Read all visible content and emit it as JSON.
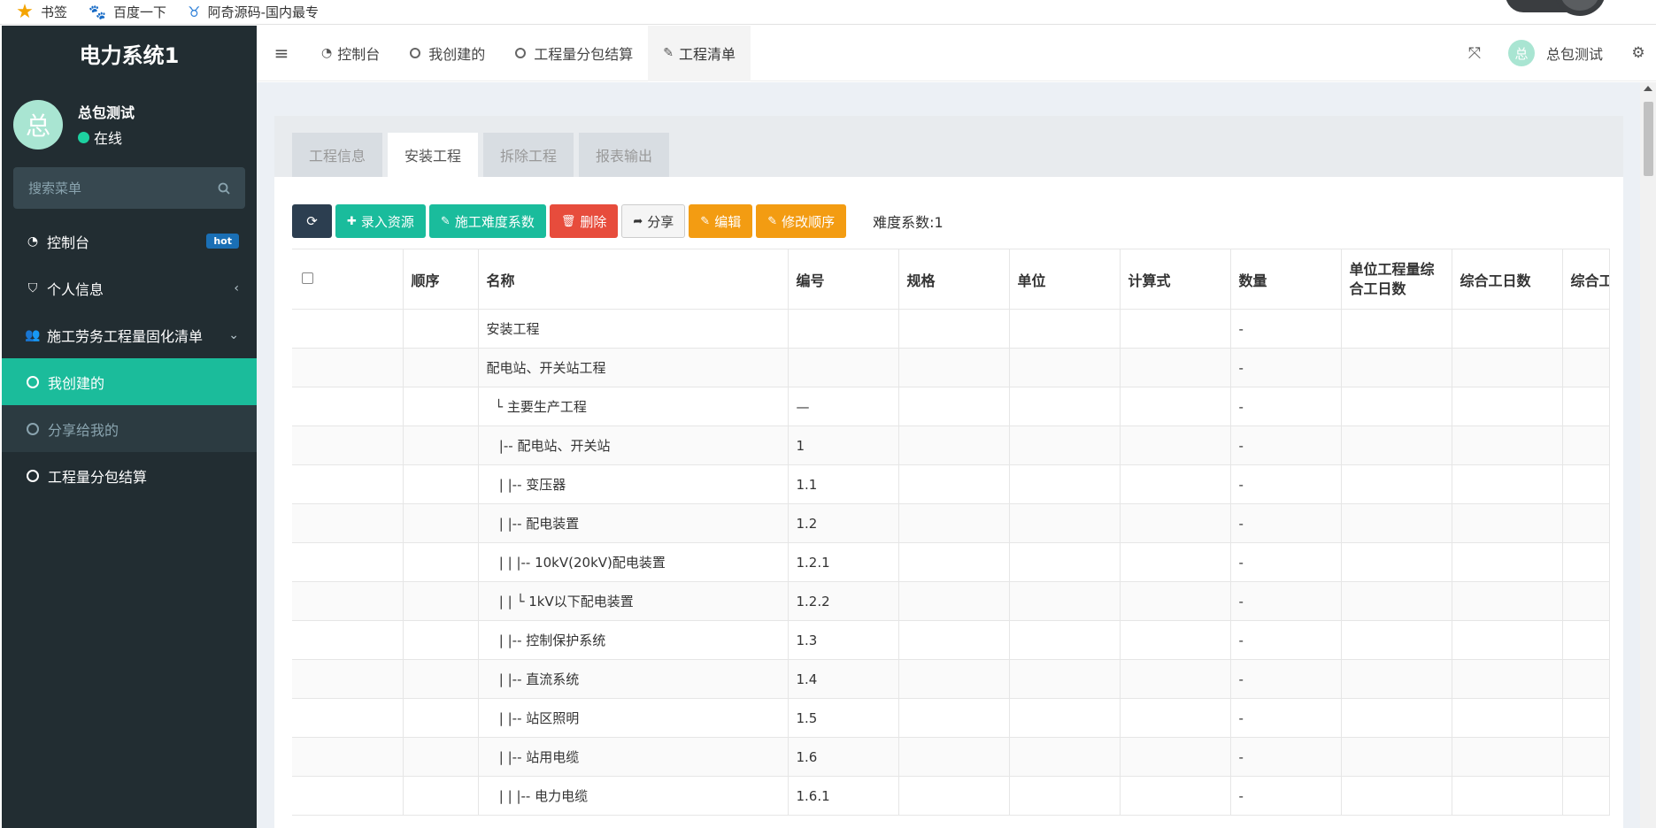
{
  "bookmarks": {
    "items": [
      {
        "label": "书签",
        "icon": "star-icon"
      },
      {
        "label": "百度一下",
        "icon": "baidu-paw-icon"
      },
      {
        "label": "阿奇源码-国内最专",
        "icon": "site-cow-icon"
      }
    ]
  },
  "sidebar": {
    "logo": "电力系统1",
    "user": {
      "avatar_char": "总",
      "name": "总包测试",
      "status": "在线"
    },
    "search_placeholder": "搜索菜单",
    "items": [
      {
        "label": "控制台",
        "icon": "dashboard-icon",
        "badge": "hot"
      },
      {
        "label": "个人信息",
        "icon": "shield-icon",
        "chevron": "‹"
      },
      {
        "label": "施工劳务工程量固化清单",
        "icon": "users-icon",
        "chevron": "⌄"
      },
      {
        "label": "我创建的",
        "icon": "circle-icon",
        "active": true
      },
      {
        "label": "分享给我的",
        "icon": "circle-icon"
      },
      {
        "label": "工程量分包结算",
        "icon": "circle-icon"
      }
    ]
  },
  "topnav": {
    "tabs": [
      {
        "label": "控制台",
        "icon": "dashboard-icon"
      },
      {
        "label": "我创建的",
        "icon": "circle-icon"
      },
      {
        "label": "工程量分包结算",
        "icon": "circle-icon"
      },
      {
        "label": "工程清单",
        "icon": "pencil-icon",
        "active": true
      }
    ],
    "user_avatar_char": "总",
    "user_name": "总包测试"
  },
  "content": {
    "tabs": [
      "工程信息",
      "安装工程",
      "拆除工程",
      "报表输出"
    ],
    "active_tab": "安装工程",
    "toolbar": {
      "refresh": "",
      "import": "录入资源",
      "difficulty_btn": "施工难度系数",
      "delete": "删除",
      "share": "分享",
      "edit": "编辑",
      "reorder": "修改顺序",
      "difficulty_text": "难度系数:1"
    },
    "table": {
      "headers": [
        "",
        "顺序",
        "名称",
        "编号",
        "规格",
        "单位",
        "计算式",
        "数量",
        "单位工程量综合工日数",
        "综合工日数",
        "综合工"
      ],
      "rows": [
        {
          "name": "安装工程",
          "code": "",
          "qty": "-"
        },
        {
          "name": "配电站、开关站工程",
          "code": "",
          "qty": "-"
        },
        {
          "name": "  └ 主要生产工程",
          "code": "—",
          "qty": "-"
        },
        {
          "name": "   |-- 配电站、开关站",
          "code": "1",
          "qty": "-"
        },
        {
          "name": "   | |-- 变压器",
          "code": "1.1",
          "qty": "-"
        },
        {
          "name": "   | |-- 配电装置",
          "code": "1.2",
          "qty": "-"
        },
        {
          "name": "   | | |-- 10kV(20kV)配电装置",
          "code": "1.2.1",
          "qty": "-"
        },
        {
          "name": "   | | └ 1kV以下配电装置",
          "code": "1.2.2",
          "qty": "-"
        },
        {
          "name": "   | |-- 控制保护系统",
          "code": "1.3",
          "qty": "-"
        },
        {
          "name": "   | |-- 直流系统",
          "code": "1.4",
          "qty": "-"
        },
        {
          "name": "   | |-- 站区照明",
          "code": "1.5",
          "qty": "-"
        },
        {
          "name": "   | |-- 站用电缆",
          "code": "1.6",
          "qty": "-"
        },
        {
          "name": "   | | |-- 电力电缆",
          "code": "1.6.1",
          "qty": "-"
        }
      ]
    }
  },
  "colors": {
    "sidebar_bg": "#222d32",
    "accent": "#1abc9c",
    "danger": "#e74c3c",
    "warning": "#f39c12"
  }
}
